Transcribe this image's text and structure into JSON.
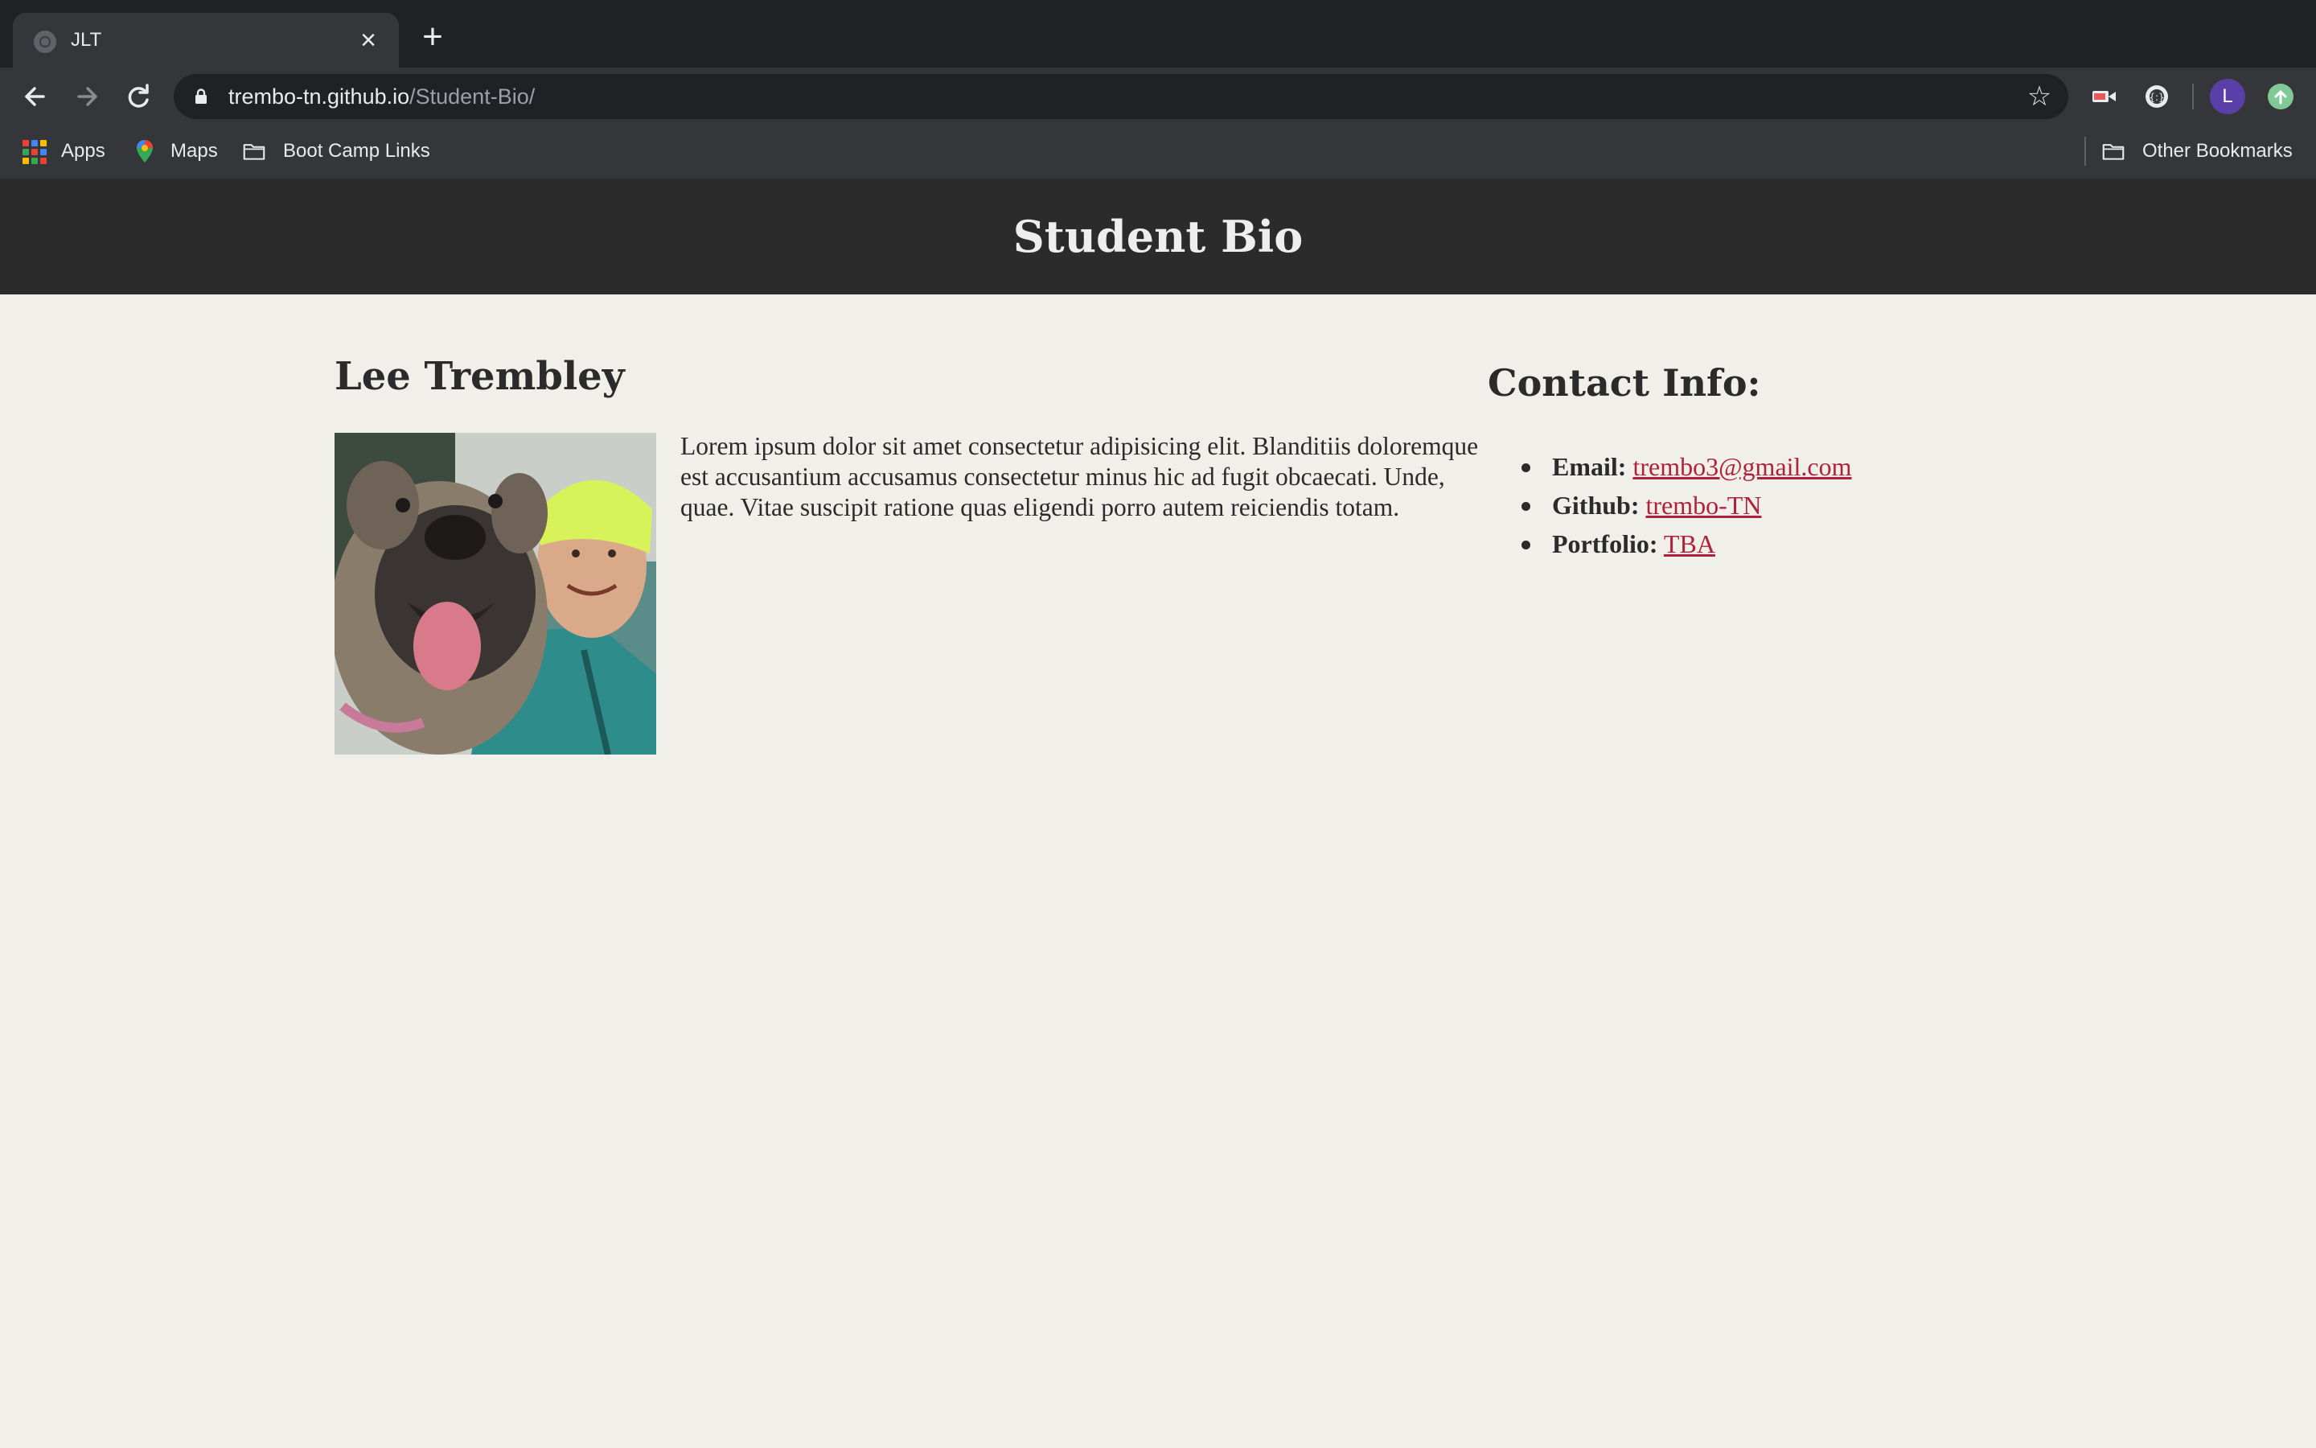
{
  "browser": {
    "tab": {
      "title": "JLT"
    },
    "address": {
      "host": "trembo-tn.github.io",
      "path": "/Student-Bio/"
    },
    "avatar_letter": "L",
    "bookmarks": [
      {
        "label": "Apps"
      },
      {
        "label": "Maps"
      },
      {
        "label": "Boot Camp Links"
      }
    ],
    "other_bookmarks": "Other Bookmarks"
  },
  "page": {
    "header_title": "Student Bio",
    "name": "Lee Trembley",
    "bio": "Lorem ipsum dolor sit amet consectetur adipisicing elit. Blanditiis doloremque est accusantium accusamus consectetur minus hic ad fugit obcaecati. Unde, quae. Vitae suscipit ratione quas eligendi porro autem reiciendis totam.",
    "contact_heading": "Contact Info:",
    "contacts": [
      {
        "label": "Email:",
        "value": "trembo3@gmail.com"
      },
      {
        "label": "Github:",
        "value": "trembo-TN"
      },
      {
        "label": "Portfolio:",
        "value": "TBA"
      }
    ]
  },
  "colors": {
    "page_bg": "#f0efea",
    "header_bg": "#2b2b2b",
    "link": "#b0213a"
  }
}
